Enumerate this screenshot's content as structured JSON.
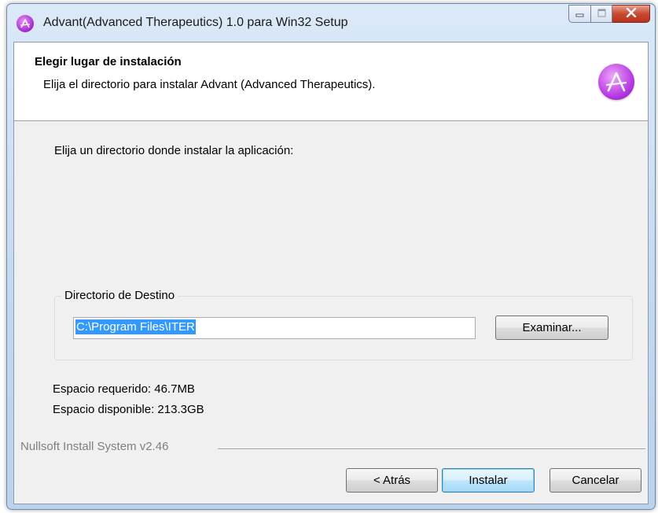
{
  "window": {
    "title": "Advant(Advanced Therapeutics) 1.0 para Win32 Setup",
    "icon": "advant-logo-icon",
    "caption_buttons": [
      "minimize-icon",
      "maximize-icon",
      "close-icon"
    ]
  },
  "header": {
    "title": "Elegir lugar de instalación",
    "subtitle": "Elija el directorio para instalar Advant (Advanced Therapeutics).",
    "logo": "advant-logo-icon"
  },
  "body": {
    "prompt": "Elija un directorio donde instalar la aplicación:",
    "destination_group": {
      "label": "Directorio de Destino",
      "path_value": "C:\\Program Files\\ITER",
      "browse_label": "Examinar..."
    },
    "space_required": "Espacio requerido: 46.7MB",
    "space_available": "Espacio disponible: 213.3GB"
  },
  "footer": {
    "branding": "Nullsoft Install System v2.46",
    "back_label": "< Atrás",
    "install_label": "Instalar",
    "cancel_label": "Cancelar"
  },
  "colors": {
    "accent": "#b335e0",
    "selection": "#3399ff",
    "close_button": "#c94a32"
  }
}
